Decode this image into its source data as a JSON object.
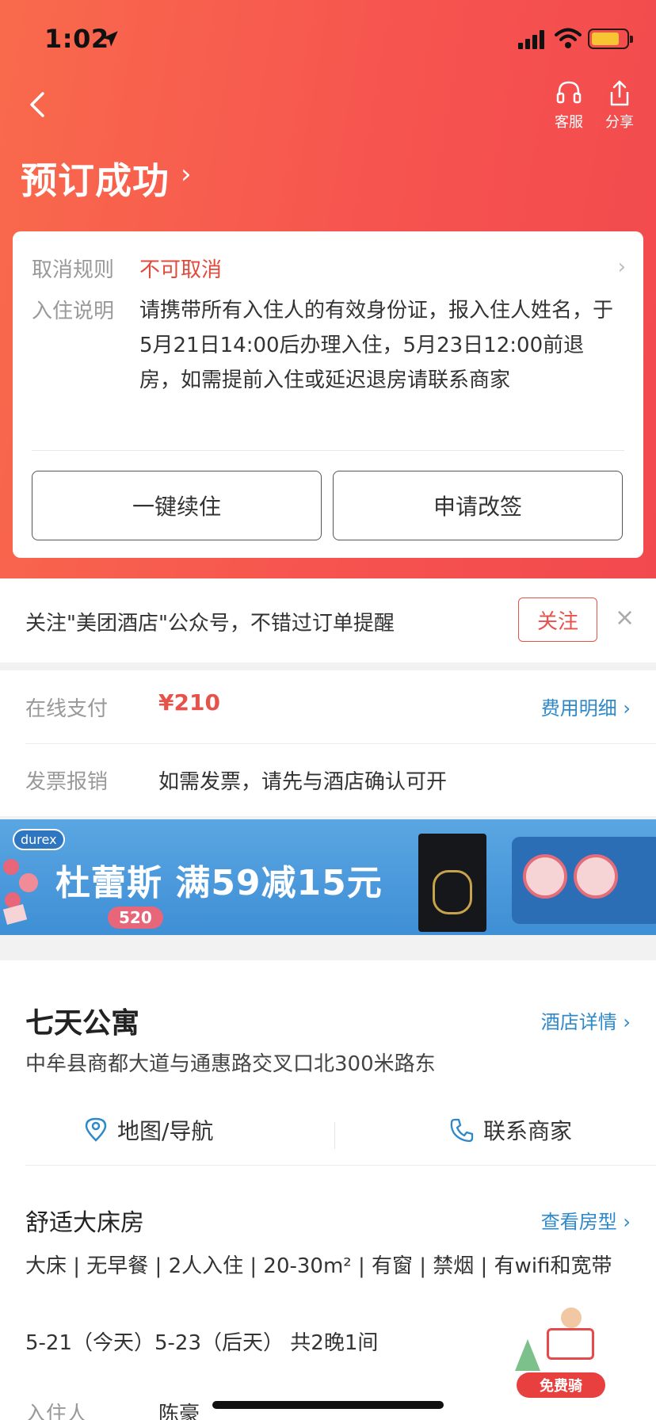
{
  "status_bar": {
    "time": "1:02"
  },
  "header": {
    "title": "预订成功",
    "title_chevron": "›",
    "actions": {
      "service_label": "客服",
      "share_label": "分享"
    }
  },
  "order_card": {
    "cancel_label": "取消规则",
    "cancel_value": "不可取消",
    "checkin_label": "入住说明",
    "checkin_text": "请携带所有入住人的有效身份证，报入住人姓名，于5月21日14:00后办理入住，5月23日12:00前退房，如需提前入住或延迟退房请联系商家",
    "renew_button": "一键续住",
    "change_button": "申请改签"
  },
  "follow_bar": {
    "text": "关注\"美团酒店\"公众号，不错过订单提醒",
    "follow_button": "关注",
    "close": "×"
  },
  "payment": {
    "online_label": "在线支付",
    "price": "¥210",
    "fee_detail_link": "费用明细 ›",
    "invoice_label": "发票报销",
    "invoice_text": "如需发票，请先与酒店确认可开"
  },
  "banner": {
    "brand": "durex",
    "text": "杜蕾斯 满59减15元",
    "tag": "520"
  },
  "hotel": {
    "name": "七天公寓",
    "detail_link": "酒店详情 ›",
    "address": "中牟县商都大道与通惠路交叉口北300米路东",
    "map_label": "地图/导航",
    "contact_label": "联系商家"
  },
  "room": {
    "name": "舒适大床房",
    "type_link": "查看房型 ›",
    "features": "大床 | 无早餐 | 2人入住 | 20-30m² | 有窗 | 禁烟 | 有wifi和宽带",
    "dates": "5-21（今天）5-23（后天） 共2晚1间",
    "guest_label": "入住人",
    "guest_name": "陈豪"
  },
  "float_badge": {
    "label": "免费骑"
  },
  "colors": {
    "header_gradient_start": "#f96a4c",
    "header_gradient_end": "#f2494e",
    "accent_red": "#e5534b",
    "link_blue": "#2f89c9"
  }
}
